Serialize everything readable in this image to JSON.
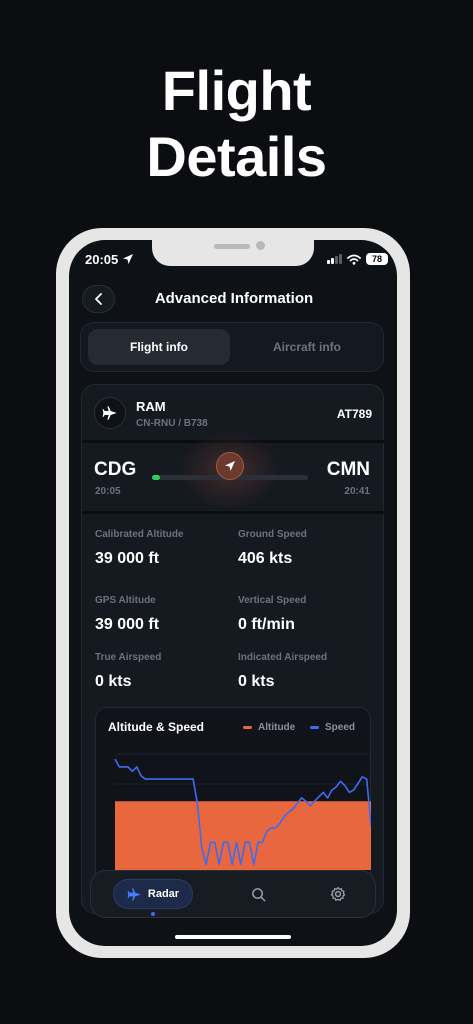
{
  "promo": {
    "line1": "Flight",
    "line2": "Details"
  },
  "status": {
    "time": "20:05",
    "battery": "78"
  },
  "header": {
    "title": "Advanced Information"
  },
  "tabs": [
    {
      "label": "Flight info",
      "active": true
    },
    {
      "label": "Aircraft info",
      "active": false
    }
  ],
  "flight": {
    "airline": "RAM",
    "registration": "CN-RNU / B738",
    "flight_number": "AT789",
    "origin": {
      "code": "CDG",
      "time": "20:05"
    },
    "destination": {
      "code": "CMN",
      "time": "20:41"
    },
    "progress": 0.05
  },
  "stats": [
    {
      "label": "Calibrated Altitude",
      "value": "39 000 ft"
    },
    {
      "label": "Ground Speed",
      "value": "406 kts"
    },
    {
      "label": "GPS Altitude",
      "value": "39 000 ft"
    },
    {
      "label": "Vertical Speed",
      "value": "0 ft/min"
    },
    {
      "label": "True Airspeed",
      "value": "0 kts"
    },
    {
      "label": "Indicated Airspeed",
      "value": "0 kts"
    }
  ],
  "chart": {
    "title": "Altitude & Speed",
    "legend": [
      {
        "name": "Altitude",
        "color": "#e8673f"
      },
      {
        "name": "Speed",
        "color": "#3d6cf0"
      }
    ]
  },
  "chart_data": {
    "type": "line",
    "title": "Altitude & Speed",
    "series": [
      {
        "name": "Altitude",
        "type": "area",
        "values": [
          62,
          62,
          62,
          62,
          62,
          62,
          62,
          62,
          62,
          62,
          62,
          62,
          62,
          62,
          62,
          62,
          62,
          62,
          62,
          62,
          62,
          62,
          62,
          62,
          62,
          62,
          62,
          62,
          62,
          62,
          62,
          62,
          62,
          62,
          62,
          62,
          62,
          62,
          62,
          62,
          62,
          62,
          62,
          62,
          62,
          62,
          62,
          62,
          62,
          62,
          62,
          62,
          62,
          62,
          62,
          62,
          62,
          62,
          62,
          62
        ]
      },
      {
        "name": "Speed",
        "type": "line",
        "values": [
          100,
          93,
          93,
          93,
          89,
          93,
          85,
          82,
          82,
          82,
          82,
          82,
          82,
          82,
          82,
          82,
          82,
          82,
          82,
          60,
          20,
          5,
          25,
          25,
          5,
          25,
          25,
          5,
          25,
          5,
          25,
          25,
          5,
          25,
          25,
          35,
          38,
          38,
          42,
          48,
          52,
          55,
          60,
          65,
          62,
          58,
          62,
          66,
          70,
          65,
          72,
          75,
          80,
          76,
          70,
          72,
          78,
          84,
          82,
          40
        ]
      }
    ],
    "ylim": [
      0,
      110
    ]
  },
  "nav": {
    "radar_label": "Radar"
  },
  "icons": {
    "back": "chevron-left-icon",
    "plane": "airplane-icon",
    "marker": "navigation-arrow-icon",
    "search": "search-icon",
    "settings": "gear-icon"
  }
}
